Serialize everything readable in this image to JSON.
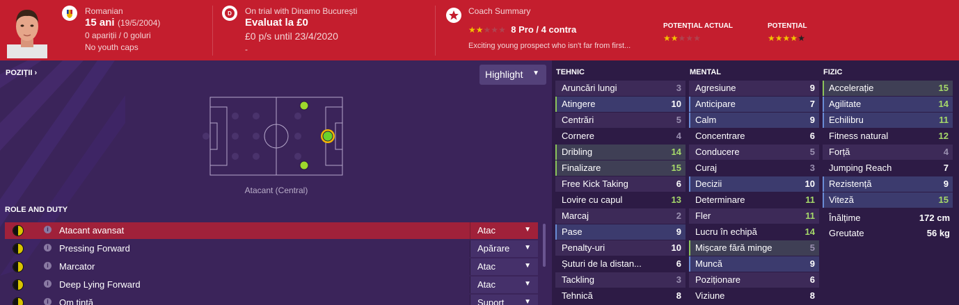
{
  "header": {
    "nationality": "Romanian",
    "age": "15 ani",
    "dob": "(19/5/2004)",
    "apps": "0 apariții / 0 goluri",
    "youth_caps": "No youth caps",
    "trial": "On trial with Dinamo București",
    "value": "Evaluat la £0",
    "wage": "£0 p/s until 23/4/2020",
    "dash": "-",
    "coach_title": "Coach Summary",
    "coach_rating": "8 Pro / 4 contra",
    "coach_rating_stars": 2,
    "coach_text": "Exciting young prospect who isn't far from first...",
    "potential_current_label": "POTENȚIAL ACTUAL",
    "potential_current_stars": 2,
    "potential_label": "POTENȚIAL",
    "potential_stars": 4
  },
  "left": {
    "positions_link": "POZIȚII ›",
    "highlight_label": "Highlight",
    "position_name": "Atacant (Central)",
    "role_title": "ROLE AND DUTY",
    "roles": [
      {
        "name": "Atacant avansat",
        "duty": "Atac"
      },
      {
        "name": "Pressing Forward",
        "duty": "Apărare"
      },
      {
        "name": "Marcator",
        "duty": "Atac"
      },
      {
        "name": "Deep Lying Forward",
        "duty": "Atac"
      },
      {
        "name": "Om țintă",
        "duty": "Suport"
      }
    ]
  },
  "attributes": {
    "tehnic_title": "TEHNIC",
    "mental_title": "MENTAL",
    "fizic_title": "FIZIC",
    "tehnic": [
      {
        "name": "Aruncări lungi",
        "value": "3"
      },
      {
        "name": "Atingere",
        "value": "10"
      },
      {
        "name": "Centrări",
        "value": "5"
      },
      {
        "name": "Cornere",
        "value": "4"
      },
      {
        "name": "Dribling",
        "value": "14"
      },
      {
        "name": "Finalizare",
        "value": "15"
      },
      {
        "name": "Free Kick Taking",
        "value": "6"
      },
      {
        "name": "Lovire cu capul",
        "value": "13"
      },
      {
        "name": "Marcaj",
        "value": "2"
      },
      {
        "name": "Pase",
        "value": "9"
      },
      {
        "name": "Penalty-uri",
        "value": "10"
      },
      {
        "name": "Șuturi de la distan...",
        "value": "6"
      },
      {
        "name": "Tackling",
        "value": "3"
      },
      {
        "name": "Tehnică",
        "value": "8"
      }
    ],
    "mental": [
      {
        "name": "Agresiune",
        "value": "9"
      },
      {
        "name": "Anticipare",
        "value": "7"
      },
      {
        "name": "Calm",
        "value": "9"
      },
      {
        "name": "Concentrare",
        "value": "6"
      },
      {
        "name": "Conducere",
        "value": "5"
      },
      {
        "name": "Curaj",
        "value": "3"
      },
      {
        "name": "Decizii",
        "value": "10"
      },
      {
        "name": "Determinare",
        "value": "11"
      },
      {
        "name": "Fler",
        "value": "11"
      },
      {
        "name": "Lucru în echipă",
        "value": "14"
      },
      {
        "name": "Mișcare fără minge",
        "value": "5"
      },
      {
        "name": "Muncă",
        "value": "9"
      },
      {
        "name": "Poziționare",
        "value": "6"
      },
      {
        "name": "Viziune",
        "value": "8"
      }
    ],
    "fizic": [
      {
        "name": "Accelerație",
        "value": "15"
      },
      {
        "name": "Agilitate",
        "value": "14"
      },
      {
        "name": "Echilibru",
        "value": "11"
      },
      {
        "name": "Fitness natural",
        "value": "12"
      },
      {
        "name": "Forță",
        "value": "4"
      },
      {
        "name": "Jumping Reach",
        "value": "7"
      },
      {
        "name": "Rezistență",
        "value": "9"
      },
      {
        "name": "Viteză",
        "value": "15"
      }
    ],
    "height_label": "Înălțime",
    "height_value": "172 cm",
    "weight_label": "Greutate",
    "weight_value": "56 kg"
  },
  "colors": {
    "header_red": "#c41e2e",
    "panel_purple": "#3b245a",
    "star_gold": "#f2c200",
    "value_green": "#a6d96a"
  }
}
